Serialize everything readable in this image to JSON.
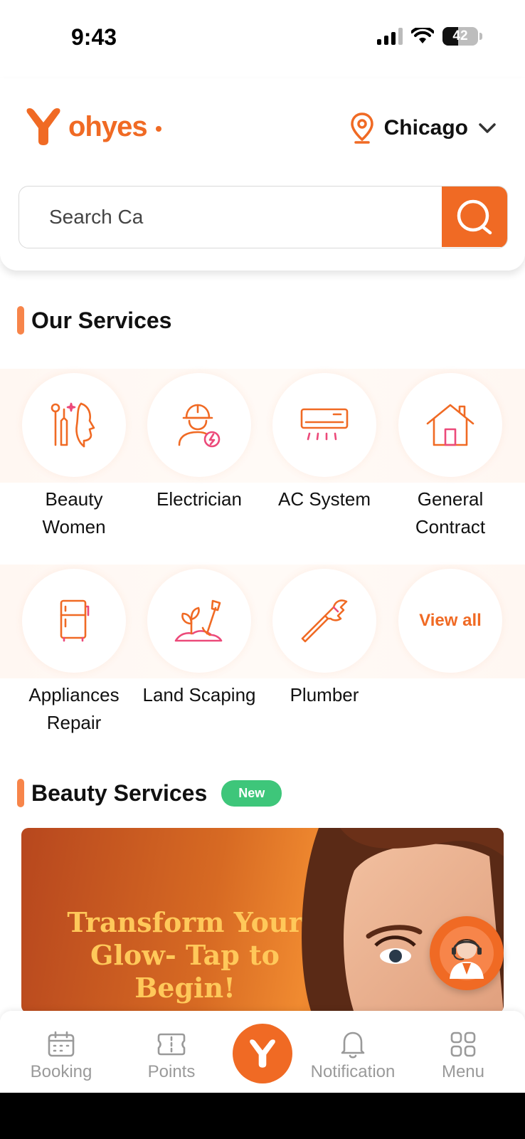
{
  "status_bar": {
    "time": "9:43",
    "battery": "42"
  },
  "header": {
    "logo_text": "ohyes",
    "location": {
      "city": "Chicago"
    },
    "search": {
      "value": "Search Ca"
    }
  },
  "services_section": {
    "title": "Our Services",
    "items": [
      {
        "label": "Beauty Women",
        "icon": "beauty-icon"
      },
      {
        "label": "Electrician",
        "icon": "electrician-icon"
      },
      {
        "label": "AC System",
        "icon": "ac-unit-icon"
      },
      {
        "label": "General Contract",
        "icon": "house-icon"
      },
      {
        "label": "Appliances Repair",
        "icon": "fridge-icon"
      },
      {
        "label": "Land Scaping",
        "icon": "plant-shovel-icon"
      },
      {
        "label": "Plumber",
        "icon": "wrench-icon"
      }
    ],
    "view_all": "View all"
  },
  "beauty_section": {
    "title": "Beauty Services",
    "badge": "New",
    "banner_text": "Transform Your Glow- Tap to Begin!"
  },
  "bottom_nav": {
    "items": [
      {
        "label": "Booking",
        "icon": "calendar-icon"
      },
      {
        "label": "Points",
        "icon": "ticket-icon"
      },
      {
        "label": "Notification",
        "icon": "bell-icon"
      },
      {
        "label": "Menu",
        "icon": "grid-icon"
      }
    ]
  },
  "colors": {
    "brand": "#f06a24",
    "badge_green": "#3ec67a",
    "nav_text": "#9a9a9a"
  }
}
